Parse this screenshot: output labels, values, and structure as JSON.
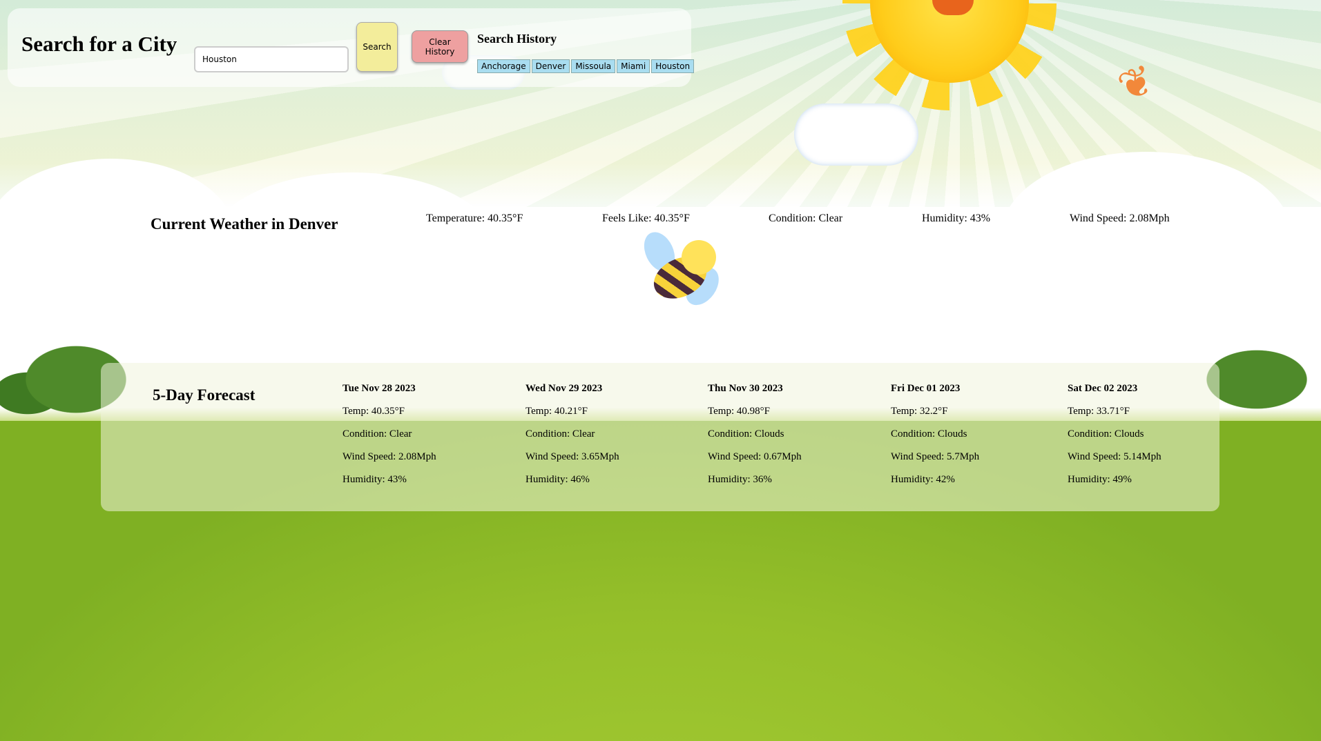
{
  "search": {
    "title": "Search for a City",
    "input_value": "Houston",
    "search_label": "Search",
    "clear_label": "Clear History"
  },
  "history": {
    "title": "Search History",
    "items": [
      "Anchorage",
      "Denver",
      "Missoula",
      "Miami",
      "Houston"
    ]
  },
  "current": {
    "title": "Current Weather in Denver",
    "temperature": "Temperature: 40.35°F",
    "feels_like": "Feels Like: 40.35°F",
    "condition": "Condition: Clear",
    "humidity": "Humidity: 43%",
    "wind": "Wind Speed: 2.08Mph"
  },
  "forecast": {
    "title": "5-Day Forecast",
    "days": [
      {
        "date": "Tue Nov 28 2023",
        "temp": "Temp: 40.35°F",
        "condition": "Condition: Clear",
        "wind": "Wind Speed: 2.08Mph",
        "humidity": "Humidity: 43%"
      },
      {
        "date": "Wed Nov 29 2023",
        "temp": "Temp: 40.21°F",
        "condition": "Condition: Clear",
        "wind": "Wind Speed: 3.65Mph",
        "humidity": "Humidity: 46%"
      },
      {
        "date": "Thu Nov 30 2023",
        "temp": "Temp: 40.98°F",
        "condition": "Condition: Clouds",
        "wind": "Wind Speed: 0.67Mph",
        "humidity": "Humidity: 36%"
      },
      {
        "date": "Fri Dec 01 2023",
        "temp": "Temp: 32.2°F",
        "condition": "Condition: Clouds",
        "wind": "Wind Speed: 5.7Mph",
        "humidity": "Humidity: 42%"
      },
      {
        "date": "Sat Dec 02 2023",
        "temp": "Temp: 33.71°F",
        "condition": "Condition: Clouds",
        "wind": "Wind Speed: 5.14Mph",
        "humidity": "Humidity: 49%"
      }
    ]
  },
  "colors": {
    "search_button": "#f3ed9b",
    "clear_button": "#eea0a0",
    "history_item": "#a9ddf0"
  }
}
